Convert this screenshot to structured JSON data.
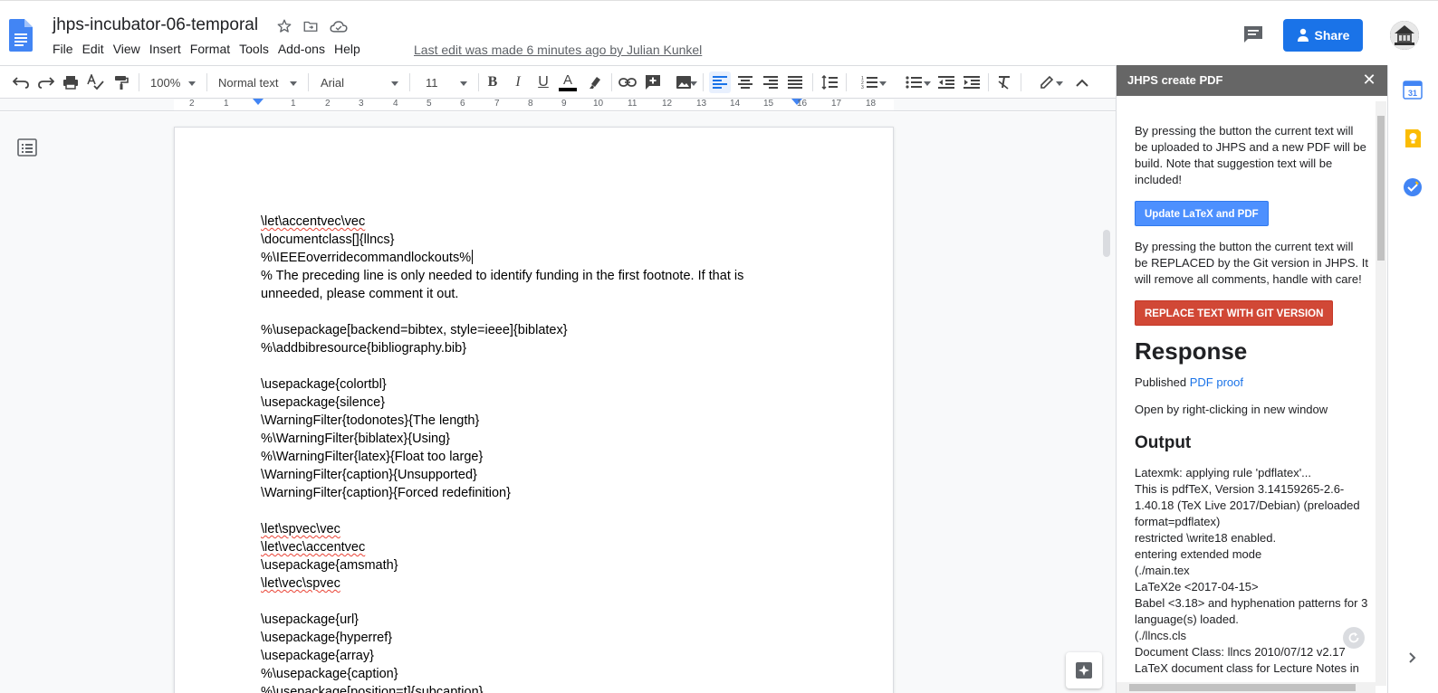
{
  "header": {
    "doc_title": "jhps-incubator-06-temporal",
    "menu": [
      "File",
      "Edit",
      "View",
      "Insert",
      "Format",
      "Tools",
      "Add-ons",
      "Help"
    ],
    "last_edit": "Last edit was made 6 minutes ago by Julian Kunkel",
    "share_label": "Share"
  },
  "toolbar": {
    "zoom": "100%",
    "style": "Normal text",
    "font": "Arial",
    "font_size": "11",
    "accent_color": "#1a73e8"
  },
  "ruler": {
    "numbers": [
      "2",
      "1",
      "1",
      "2",
      "3",
      "4",
      "5",
      "6",
      "7",
      "8",
      "9",
      "10",
      "11",
      "12",
      "13",
      "14",
      "15",
      "16",
      "17",
      "18"
    ]
  },
  "document": {
    "lines": [
      {
        "text": "\\let\\accentvec\\vec",
        "squiggle": "\\let\\accentvec\\vec"
      },
      {
        "text": "\\documentclass[]{llncs}"
      },
      {
        "text": "%\\IEEEoverridecommandlockouts%"
      },
      {
        "text": "% The preceding line is only needed to identify funding in the first footnote. If that is unneeded, please comment it out."
      },
      {
        "text": ""
      },
      {
        "text": "%\\usepackage[backend=bibtex, style=ieee]{biblatex}"
      },
      {
        "text": "%\\addbibresource{bibliography.bib}"
      },
      {
        "text": ""
      },
      {
        "text": "\\usepackage{colortbl}"
      },
      {
        "text": "\\usepackage{silence}"
      },
      {
        "text": "\\WarningFilter{todonotes}{The length}"
      },
      {
        "text": "%\\WarningFilter{biblatex}{Using}"
      },
      {
        "text": "%\\WarningFilter{latex}{Float too large}"
      },
      {
        "text": "\\WarningFilter{caption}{Unsupported}"
      },
      {
        "text": "\\WarningFilter{caption}{Forced redefinition}"
      },
      {
        "text": ""
      },
      {
        "text": "\\let\\spvec\\vec",
        "squiggle": "\\let\\spvec\\vec"
      },
      {
        "text": "\\let\\vec\\accentvec",
        "squiggle": "\\let\\vec\\accentvec"
      },
      {
        "text": "\\usepackage{amsmath}"
      },
      {
        "text": "\\let\\vec\\spvec",
        "squiggle": "\\let\\vec\\spvec"
      },
      {
        "text": ""
      },
      {
        "text": "\\usepackage{url}"
      },
      {
        "text": "\\usepackage{hyperref}"
      },
      {
        "text": "\\usepackage{array}"
      },
      {
        "text": "%\\usepackage{caption}"
      },
      {
        "text": "%\\usepackage[position=t]{subcaption}"
      }
    ]
  },
  "side_panel": {
    "title": "JHPS create PDF",
    "update_desc": "By pressing the button the current text will be uploaded to JHPS and a new PDF will be build. Note that suggestion text will be included!",
    "update_button": "Update LaTeX and PDF",
    "replace_desc": "By pressing the button the current text will be REPLACED by the Git version in JHPS. It will remove all comments, handle with care!",
    "replace_button": "REPLACE TEXT WITH GIT VERSION",
    "response_heading": "Response",
    "published_prefix": "Published",
    "published_link": "PDF proof",
    "open_hint": "Open by right-clicking in new window",
    "output_heading": "Output",
    "output_lines": [
      "Latexmk: applying rule 'pdflatex'...",
      "This is pdfTeX, Version 3.14159265-2.6-1.40.18 (TeX Live 2017/Debian) (preloaded format=pdflatex)",
      "restricted \\write18 enabled.",
      "entering extended mode",
      "(./main.tex",
      "LaTeX2e <2017-04-15>",
      "Babel <3.18> and hyphenation patterns for 3 language(s) loaded.",
      "(./llncs.cls",
      "Document Class: llncs 2010/07/12 v2.17",
      "LaTeX document class for Lecture Notes in"
    ]
  },
  "right_rail": {
    "calendar_label": "31"
  }
}
